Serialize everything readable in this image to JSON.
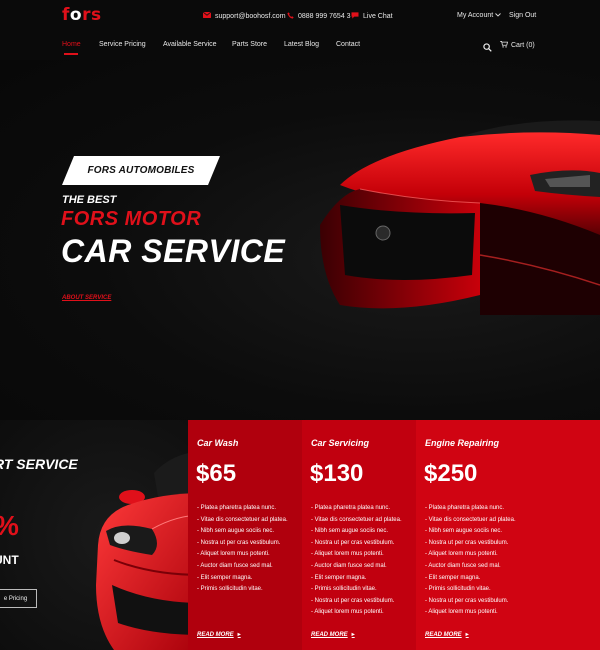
{
  "brand": {
    "logo": "fors"
  },
  "topbar": {
    "email": "support@boohosf.com",
    "phone": "0888 999 7654 3",
    "chat": "Live Chat",
    "account": "My Account",
    "signout": "Sign Out"
  },
  "nav": {
    "items": [
      {
        "label": "Home",
        "active": true
      },
      {
        "label": "Service Pricing"
      },
      {
        "label": "Available Service"
      },
      {
        "label": "Parts Store"
      },
      {
        "label": "Latest Blog"
      },
      {
        "label": "Contact"
      }
    ],
    "cart": "Cart (0)"
  },
  "hero": {
    "badge": "FORS AUTOMOBILES",
    "eyebrow": "THE BEST",
    "title_red": "FORS MOTOR",
    "title_white": "CAR SERVICE",
    "link": "ABOUT SERVICE"
  },
  "services": {
    "heading": "RT SERVICE",
    "percent": "%",
    "discount": "UNT",
    "button": "e Pricing",
    "cards": [
      {
        "name": "Car Wash",
        "price": "$65",
        "items": [
          "- Platea pharetra platea nunc.",
          "- Vitae dis consectetuer ad platea.",
          "- Nibh sem augue sociis nec.",
          "- Nostra ut per cras vestibulum.",
          "- Aliquet lorem mus potenti.",
          "- Auctor diam fusce sed mal.",
          "- Elit semper magna.",
          "- Primis sollicitudin vitae."
        ],
        "more": "READ MORE"
      },
      {
        "name": "Car Servicing",
        "price": "$130",
        "items": [
          "- Platea pharetra platea nunc.",
          "- Vitae dis consectetuer ad platea.",
          "- Nibh sem augue sociis nec.",
          "- Nostra ut per cras vestibulum.",
          "- Aliquet lorem mus potenti.",
          "- Auctor diam fusce sed mal.",
          "- Elit semper magna.",
          "- Primis sollicitudin vitae.",
          "- Nostra ut per cras vestibulum.",
          "- Aliquet lorem mus potenti."
        ],
        "more": "READ MORE"
      },
      {
        "name": "Engine Repairing",
        "price": "$250",
        "items": [
          "- Platea pharetra platea nunc.",
          "- Vitae dis consectetuer ad platea.",
          "- Nibh sem augue sociis nec.",
          "- Nostra ut per cras vestibulum.",
          "- Aliquet lorem mus potenti.",
          "- Auctor diam fusce sed mal.",
          "- Elit semper magna.",
          "- Primis sollicitudin vitae.",
          "- Nostra ut per cras vestibulum.",
          "- Aliquet lorem mus potenti."
        ],
        "more": "READ MORE"
      }
    ]
  },
  "colors": {
    "accent": "#e0101a",
    "card1": "#b0000d",
    "card2": "#c1000f",
    "card3": "#d00412",
    "background": "#0a0a0a"
  }
}
